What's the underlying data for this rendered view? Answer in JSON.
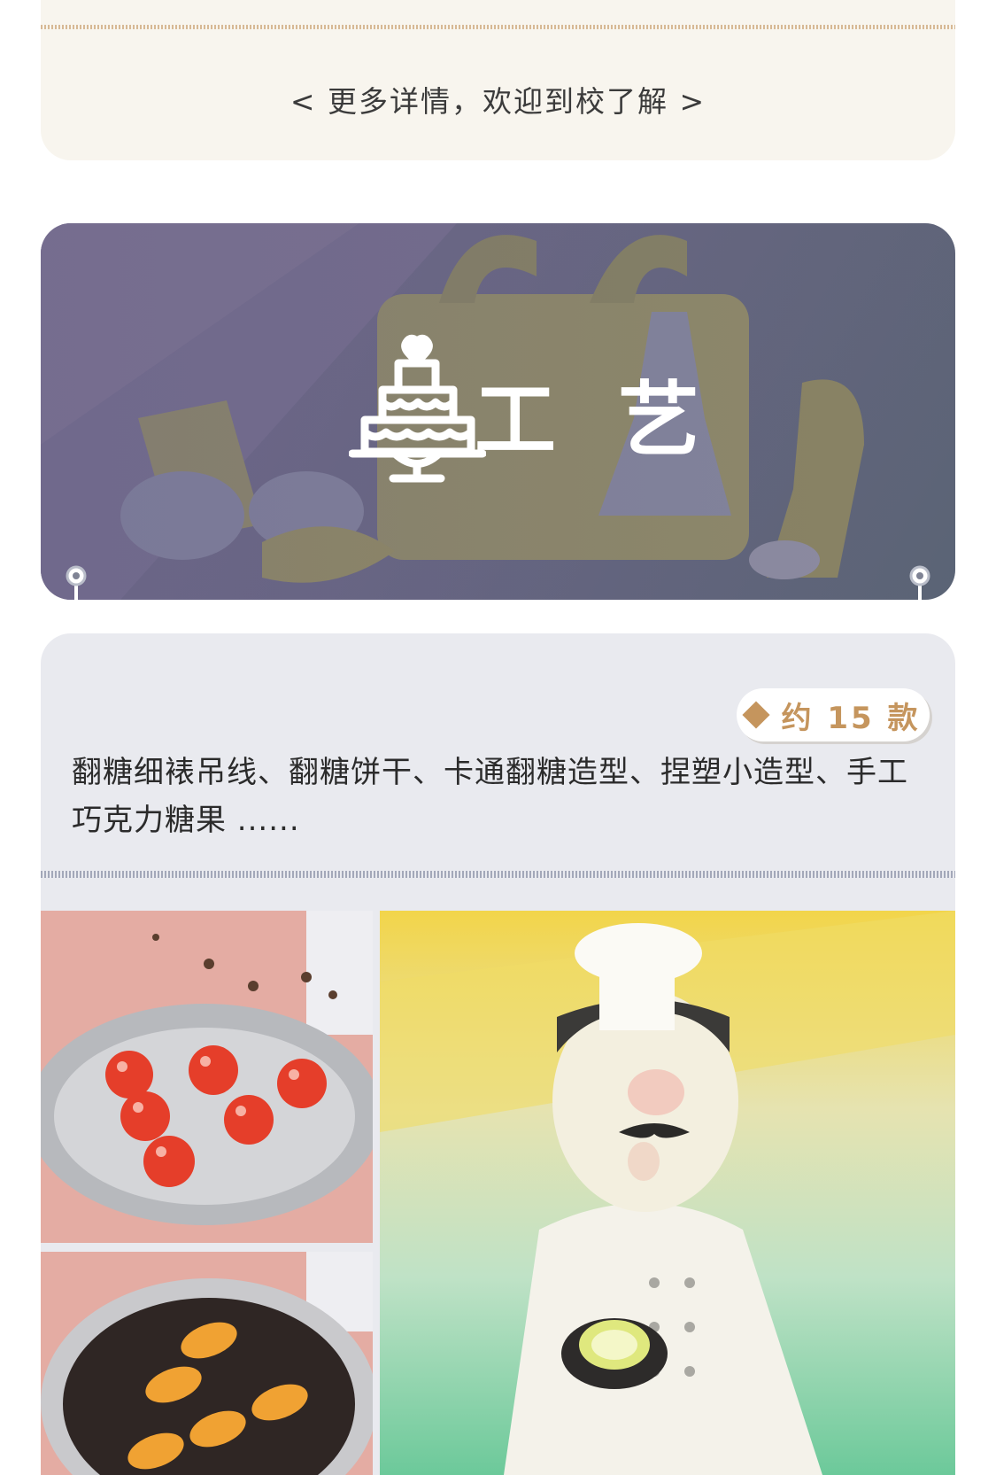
{
  "intro": {
    "more_details": "< 更多详情，欢迎到校了解 >"
  },
  "craft_section": {
    "title": "工艺",
    "icon": "cake-icon",
    "count_badge": "约 15 款",
    "description": "翻糖细裱吊线、翻糖饼干、卡通翻糖造型、捏塑小造型、手工巧克力糖果 ......"
  },
  "colors": {
    "accent_gold": "#c5955d",
    "card_cream": "#f8f5ee",
    "card_gray": "#e9eaef"
  }
}
